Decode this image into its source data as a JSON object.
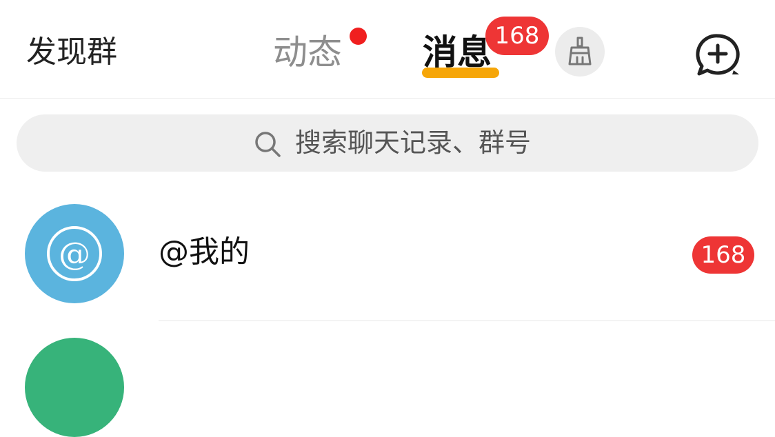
{
  "header": {
    "discover_label": "发现群",
    "tabs": [
      {
        "label": "动态",
        "has_dot": true
      },
      {
        "label": "消息",
        "active": true,
        "badge": "168"
      }
    ],
    "icons": {
      "clean": "broom-icon",
      "add_chat": "chat-plus-icon"
    }
  },
  "search": {
    "placeholder": "搜索聊天记录、群号",
    "icon": "search-icon"
  },
  "list": [
    {
      "title": "@我的",
      "badge": "168",
      "avatar_color": "#5bb4de",
      "avatar_icon": "at-icon"
    }
  ],
  "colors": {
    "accent": "#f6a609",
    "badge": "#ee3535",
    "muted_tab": "#8e8e8e"
  }
}
